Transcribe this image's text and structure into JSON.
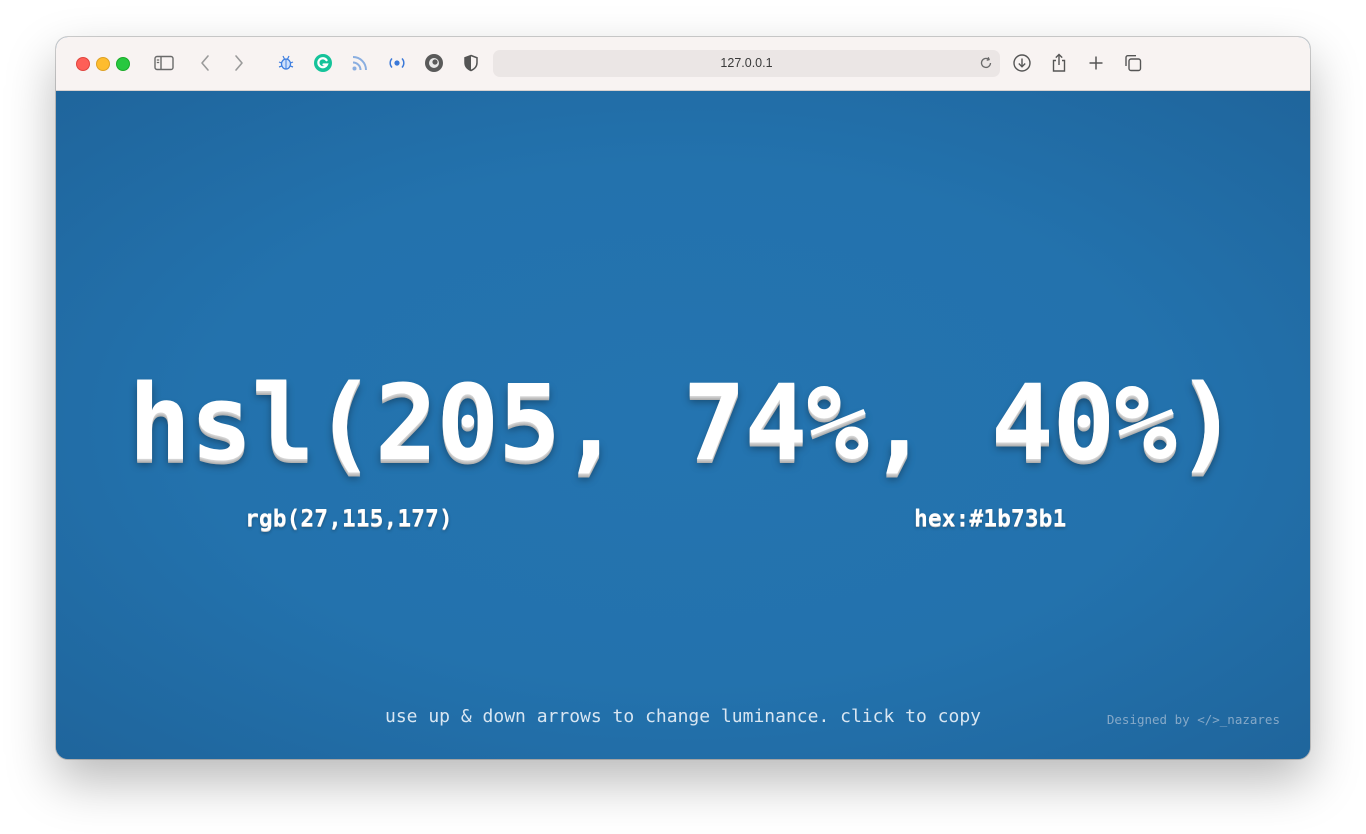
{
  "browser": {
    "url": "127.0.0.1",
    "icons": [
      "sidebar-icon",
      "back-icon",
      "forward-icon",
      "bug-extension-icon",
      "grammarly-icon",
      "rss-icon",
      "radar-extension-icon",
      "camera-extension-icon",
      "shield-icon",
      "reload-icon",
      "download-icon",
      "share-icon",
      "new-tab-icon",
      "tabs-overview-icon"
    ]
  },
  "page": {
    "background_color": "#1b73b1",
    "hsl_text": "hsl(205, 74%, 40%)",
    "rgb_text": "rgb(27,115,177)",
    "hex_text": "hex:#1b73b1",
    "hint_text": "use up & down arrows to change luminance. click to copy",
    "credit_prefix": "Designed by",
    "credit_author": "</>_nazares"
  }
}
